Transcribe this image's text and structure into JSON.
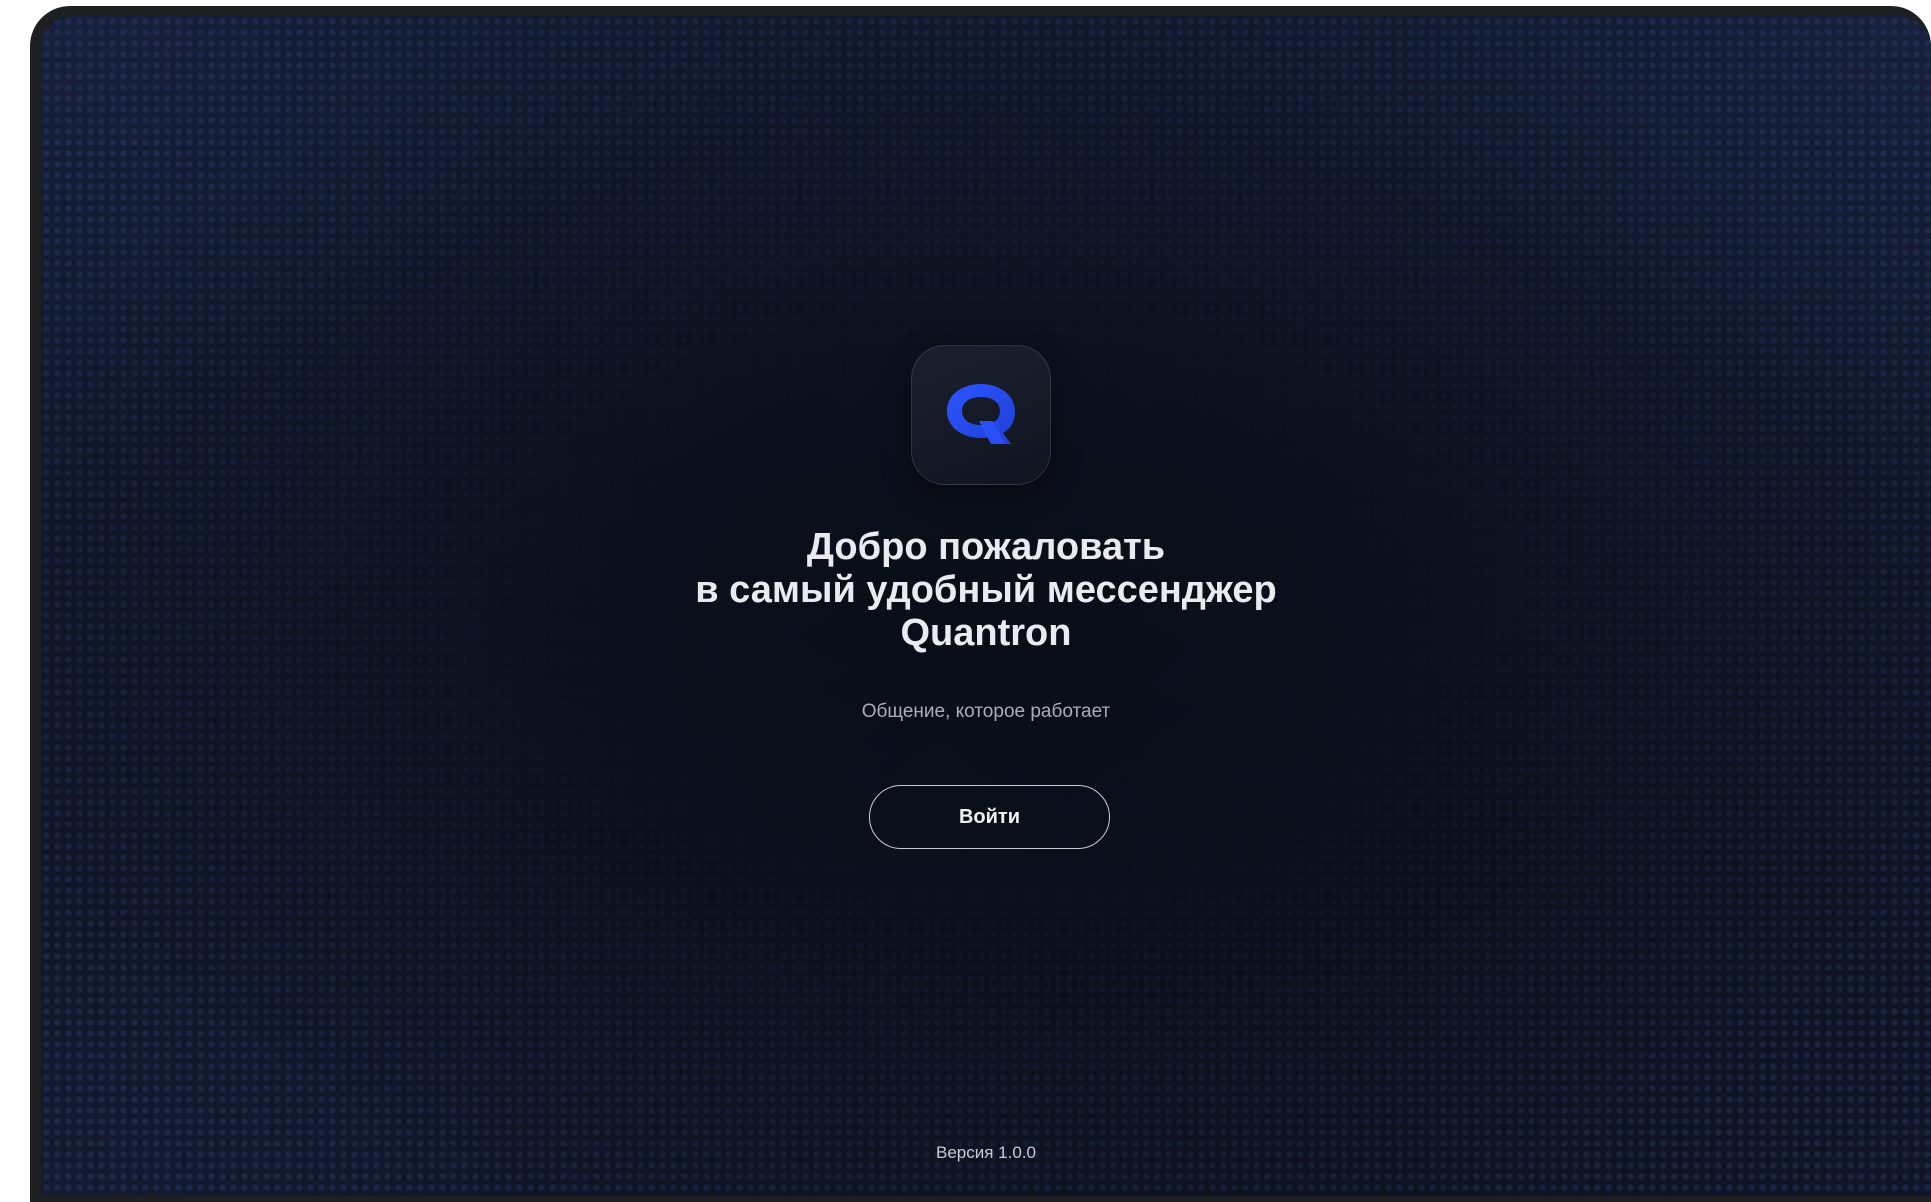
{
  "app": {
    "logo_icon": "q-logo-icon",
    "accent_color": "#2346e8",
    "background_color": "#0a0e18"
  },
  "welcome": {
    "title_line1": "Добро пожаловать",
    "title_line2": "в самый удобный мессенджер",
    "title_line3": "Quantron",
    "subtitle": "Общение, которое работает",
    "login_label": "Войти"
  },
  "footer": {
    "version": "Версия 1.0.0"
  }
}
